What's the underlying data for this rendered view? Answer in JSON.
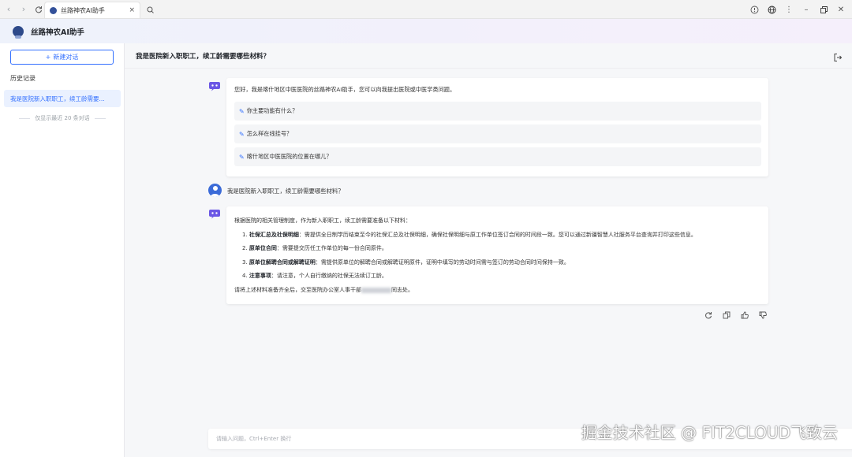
{
  "browser": {
    "tab_title": "丝路神农AI助手",
    "tab_close": "×"
  },
  "app": {
    "title": "丝路神农AI助手"
  },
  "sidebar": {
    "new_chat_label": "新建对话",
    "history_label": "历史记录",
    "history_items": [
      {
        "label": "我是医院新入职职工，续工龄需要..."
      }
    ],
    "history_note": "仅显示最近 20 条对话"
  },
  "main": {
    "title": "我是医院新入职职工，续工龄需要哪些材料？",
    "greeting": "您好，我是喀什地区中医医院的丝路神农AI助手，您可以向我提出医院或中医学类问题。",
    "suggestions": [
      "你主要功能有什么？",
      "怎么样在线挂号？",
      "喀什地区中医医院的位置在哪儿？"
    ],
    "user_question": "我是医院新入职职工，续工龄需要哪些材料？",
    "answer": {
      "intro": "根据医院的相关管理制度，作为新入职职工，续工龄需要准备以下材料：",
      "items": [
        {
          "num": "1.",
          "title": "社保汇总及社保明细",
          "text": "：需提供全日制学历结束至今的社保汇总及社保明细，确保社保明细与原工作单位签订合同的时间段一致。您可以通过新疆智慧人社服务平台查询并打印这些信息。"
        },
        {
          "num": "2.",
          "title": "原单位合同",
          "text": "：需要提交历任工作单位的每一份合同原件。"
        },
        {
          "num": "3.",
          "title": "原单位解聘合同或解聘证明",
          "text": "：需提供原单位的解聘合同或解聘证明原件，证明中填写的劳动时间需与签订的劳动合同时间保持一致。"
        },
        {
          "num": "4.",
          "title": "注意事项",
          "text": "：请注意，个人自行缴纳的社保无法续订工龄。"
        }
      ],
      "closing_before": "请将上述材料准备齐全后，交至医院办公室人事干部",
      "closing_after": "同志处。"
    }
  },
  "input": {
    "placeholder": "请输入问题，Ctrl+Enter 换行"
  },
  "watermark": "掘金技术社区 @ FIT2CLOUD飞致云",
  "colors": {
    "accent": "#3370ff",
    "user_avatar": "#3b6bd8",
    "bot_icon": "#6b57e5"
  }
}
